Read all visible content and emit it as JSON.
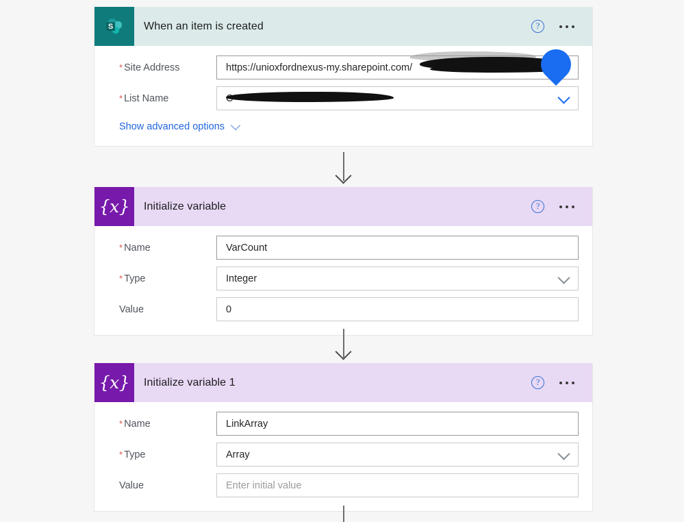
{
  "theme": {
    "page_background": "#f6f6f6",
    "sharepoint_accent": "#0f7b7b",
    "sharepoint_header": "#dceaea",
    "variables_accent": "#7719aa",
    "variables_header": "#e8d9f5",
    "link_blue": "#2266dd",
    "required_red": "#d9544a",
    "redaction_ink": "#111111",
    "drop_blue": "#1a6cf0"
  },
  "cards": [
    {
      "id": "trigger",
      "title": "When an item is created",
      "icon": "sharepoint-icon",
      "help_label": "?",
      "menu_label": "...",
      "fields": [
        {
          "label": "Site Address",
          "required": true,
          "value": "https://unioxfordnexus-my.sharepoint.com/",
          "control": "text",
          "redacted": true,
          "clear_icon": "clear-x-icon"
        },
        {
          "label": "List Name",
          "required": true,
          "value": "C",
          "control": "dropdown",
          "redacted": true,
          "chevron": "chevron-down-icon"
        }
      ],
      "advanced_options_label": "Show advanced options"
    },
    {
      "id": "initialize-variable",
      "title": "Initialize variable",
      "icon": "variables-icon",
      "icon_glyph": "{x}",
      "help_label": "?",
      "menu_label": "...",
      "fields": [
        {
          "label": "Name",
          "required": true,
          "value": "VarCount",
          "control": "text"
        },
        {
          "label": "Type",
          "required": true,
          "value": "Integer",
          "control": "dropdown"
        },
        {
          "label": "Value",
          "required": false,
          "value": "0",
          "control": "text"
        }
      ]
    },
    {
      "id": "initialize-variable-1",
      "title": "Initialize variable 1",
      "icon": "variables-icon",
      "icon_glyph": "{x}",
      "help_label": "?",
      "menu_label": "...",
      "fields": [
        {
          "label": "Name",
          "required": true,
          "value": "LinkArray",
          "control": "text"
        },
        {
          "label": "Type",
          "required": true,
          "value": "Array",
          "control": "dropdown"
        },
        {
          "label": "Value",
          "required": false,
          "value": "",
          "placeholder": "Enter initial value",
          "control": "text"
        }
      ]
    }
  ]
}
